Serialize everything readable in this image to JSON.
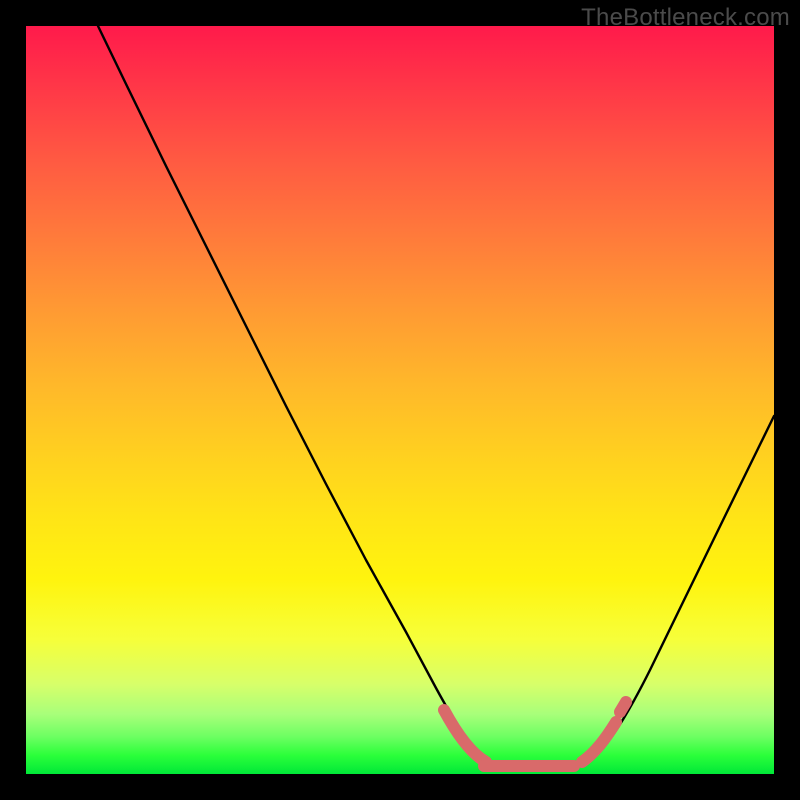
{
  "watermark": "TheBottleneck.com",
  "colors": {
    "frame": "#000000",
    "curve": "#000000",
    "trough_highlight": "#d96a6a",
    "gradient_top": "#ff1a4b",
    "gradient_bottom": "#00e838"
  },
  "chart_data": {
    "type": "line",
    "title": "",
    "xlabel": "",
    "ylabel": "",
    "xlim": [
      0,
      100
    ],
    "ylim": [
      0,
      100
    ],
    "note": "No axes or tick labels rendered; values estimated from curve shape in a 0–100 × 0–100 plot space where y is percent height from bottom.",
    "series": [
      {
        "name": "bottleneck-curve",
        "x": [
          0,
          5,
          10,
          15,
          20,
          25,
          30,
          35,
          40,
          45,
          50,
          55,
          60,
          63,
          66,
          70,
          75,
          80,
          85,
          90,
          95,
          100
        ],
        "values": [
          100,
          92,
          84,
          76,
          68,
          60,
          52,
          44,
          36,
          28,
          20,
          12,
          5,
          2,
          1,
          1,
          2,
          6,
          14,
          24,
          36,
          48
        ]
      }
    ],
    "trough_highlight": {
      "x_range": [
        55,
        75
      ],
      "y_approx": 1
    }
  }
}
